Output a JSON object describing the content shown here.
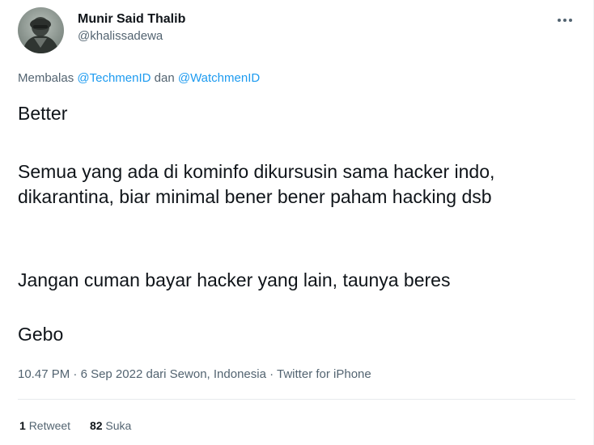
{
  "author": {
    "display_name": "Munir Said Thalib",
    "handle": "@khalissadewa"
  },
  "reply": {
    "prefix": "Membalas",
    "mention_1": "@TechmenID",
    "joiner": "dan",
    "mention_2": "@WatchmenID"
  },
  "tweet": {
    "paragraphs": [
      "Better",
      "Semua yang ada di kominfo dikursusin sama hacker indo, dikarantina, biar minimal bener bener paham hacking dsb",
      "Jangan cuman bayar hacker yang lain, taunya beres",
      "Gebo"
    ]
  },
  "meta": {
    "time": "10.47 PM",
    "date": "6 Sep 2022",
    "location_prefix": "dari",
    "location": "Sewon, Indonesia",
    "source": "Twitter for iPhone",
    "separator": "·"
  },
  "stats": {
    "retweets_count": "1",
    "retweets_label": "Retweet",
    "likes_count": "82",
    "likes_label": "Suka"
  },
  "icons": {
    "more": "more-horizontal-icon",
    "avatar": "user-avatar"
  },
  "colors": {
    "text": "#0f1419",
    "secondary": "#536471",
    "link": "#1d9bf0",
    "divider": "#e7ebed"
  }
}
